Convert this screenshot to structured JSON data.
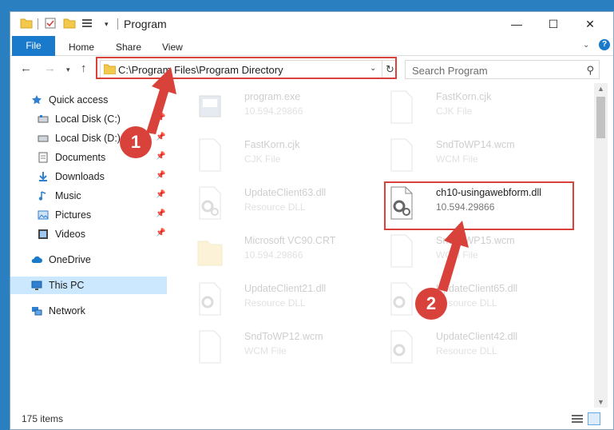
{
  "window": {
    "title": "Program"
  },
  "ribbon": {
    "tabs": [
      {
        "label": "File"
      },
      {
        "label": "Home"
      },
      {
        "label": "Share"
      },
      {
        "label": "View"
      }
    ]
  },
  "address_bar": {
    "path": "C:\\Program Files\\Program Directory"
  },
  "search": {
    "placeholder": "Search Program"
  },
  "sidebar": {
    "items": [
      {
        "label": "Quick access",
        "icon": "star-icon"
      },
      {
        "label": "Local Disk (C:)",
        "icon": "disk-icon",
        "pinned": true
      },
      {
        "label": "Local Disk (D:)",
        "icon": "disk-icon",
        "pinned": true
      },
      {
        "label": "Documents",
        "icon": "documents-icon",
        "pinned": true
      },
      {
        "label": "Downloads",
        "icon": "download-icon",
        "pinned": true
      },
      {
        "label": "Music",
        "icon": "music-icon",
        "pinned": true
      },
      {
        "label": "Pictures",
        "icon": "pictures-icon",
        "pinned": true
      },
      {
        "label": "Videos",
        "icon": "videos-icon",
        "pinned": true
      },
      {
        "label": "OneDrive",
        "icon": "cloud-icon"
      },
      {
        "label": "This PC",
        "icon": "computer-icon",
        "selected": true
      },
      {
        "label": "Network",
        "icon": "network-icon"
      }
    ]
  },
  "files": [
    {
      "name": "program.exe",
      "type": "10.594.29866",
      "icon": "exe-icon",
      "faded": true
    },
    {
      "name": "FastKorn.cjk",
      "type": "CJK File",
      "icon": "generic-file-icon",
      "faded": true
    },
    {
      "name": "FastKorn.cjk",
      "type": "CJK File",
      "icon": "generic-file-icon",
      "faded": true
    },
    {
      "name": "SndToWP14.wcm",
      "type": "WCM File",
      "icon": "generic-file-icon",
      "faded": true
    },
    {
      "name": "UpdateClient63.dll",
      "type": "Resource DLL",
      "icon": "dll-icon",
      "faded": true
    },
    {
      "name": "ch10-usingawebform.dll",
      "type": "10.594.29866",
      "icon": "dll-icon",
      "faded": false,
      "highlighted": true
    },
    {
      "name": "Microsoft VC90.CRT",
      "type": "10.594.29866",
      "icon": "folder-icon",
      "faded": true
    },
    {
      "name": "SndToWP15.wcm",
      "type": "WCM File",
      "icon": "generic-file-icon",
      "faded": true
    },
    {
      "name": "UpdateClient21.dll",
      "type": "Resource DLL",
      "icon": "dll-icon",
      "faded": true
    },
    {
      "name": "UpdateClient65.dll",
      "type": "Resource DLL",
      "icon": "dll-icon",
      "faded": true
    },
    {
      "name": "SndToWP12.wcm",
      "type": "WCM File",
      "icon": "generic-file-icon",
      "faded": true
    },
    {
      "name": "UpdateClient42.dll",
      "type": "Resource DLL",
      "icon": "dll-icon",
      "faded": true
    }
  ],
  "status": {
    "item_count": "175 items"
  },
  "callouts": [
    {
      "number": "1"
    },
    {
      "number": "2"
    }
  ],
  "colors": {
    "accent": "#1979ca",
    "highlight": "#d9413b",
    "selection": "#cce8ff"
  }
}
